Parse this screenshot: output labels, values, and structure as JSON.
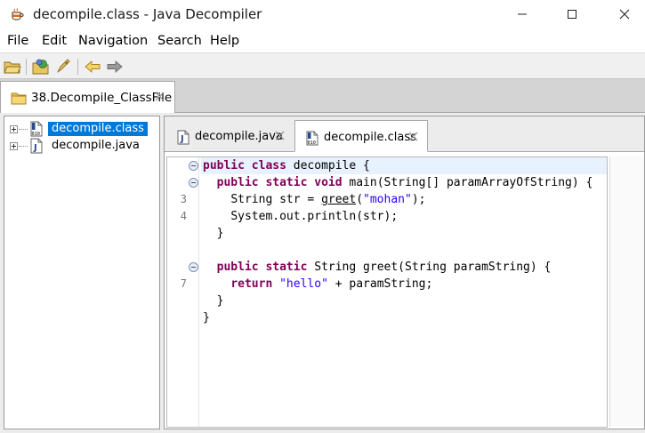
{
  "window": {
    "title": "decompile.class - Java Decompiler",
    "icon": "coffee-cup-icon"
  },
  "menu": {
    "items": [
      "File",
      "Edit",
      "Navigation",
      "Search",
      "Help"
    ]
  },
  "toolbar": {
    "buttons": [
      "open-folder-icon",
      "open-type-icon",
      "search-rocket-icon",
      "back-arrow-icon",
      "forward-arrow-icon"
    ]
  },
  "outer_tab": {
    "label": "38.Decompile_ClassFile"
  },
  "tree": {
    "items": [
      {
        "label": "decompile.class",
        "icon": "class-file-icon",
        "selected": true
      },
      {
        "label": "decompile.java",
        "icon": "java-file-icon",
        "selected": false
      }
    ]
  },
  "editor_tabs": [
    {
      "label": "decompile.java",
      "icon": "java-file-icon",
      "active": false
    },
    {
      "label": "decompile.class",
      "icon": "class-file-icon",
      "active": true
    }
  ],
  "code": {
    "lines": [
      {
        "num": "",
        "fold": true
      },
      {
        "num": "",
        "fold": true
      },
      {
        "num": "3",
        "fold": false
      },
      {
        "num": "4",
        "fold": false
      },
      {
        "num": "",
        "fold": false
      },
      {
        "num": "",
        "fold": false
      },
      {
        "num": "",
        "fold": true
      },
      {
        "num": "7",
        "fold": false
      },
      {
        "num": "",
        "fold": false
      },
      {
        "num": "",
        "fold": false
      }
    ],
    "tokens": {
      "l1_kw1": "public",
      "l1_kw2": "class",
      "l1_rest": " decompile {",
      "l2_kw1": "public",
      "l2_kw2": "static",
      "l2_kw3": "void",
      "l2_rest": " main(String[] paramArrayOfString) {",
      "l3_a": "String str = ",
      "l3_call": "greet",
      "l3_b": "(",
      "l3_str": "\"mohan\"",
      "l3_c": ");",
      "l4": "System.out.println(str);",
      "l5": "}",
      "l7_kw1": "public",
      "l7_kw2": "static",
      "l7_rest": " String greet(String paramString) {",
      "l8_kw": "return",
      "l8_str": "\"hello\"",
      "l8_rest": " + paramString;",
      "l9": "}",
      "l10": "}"
    }
  }
}
